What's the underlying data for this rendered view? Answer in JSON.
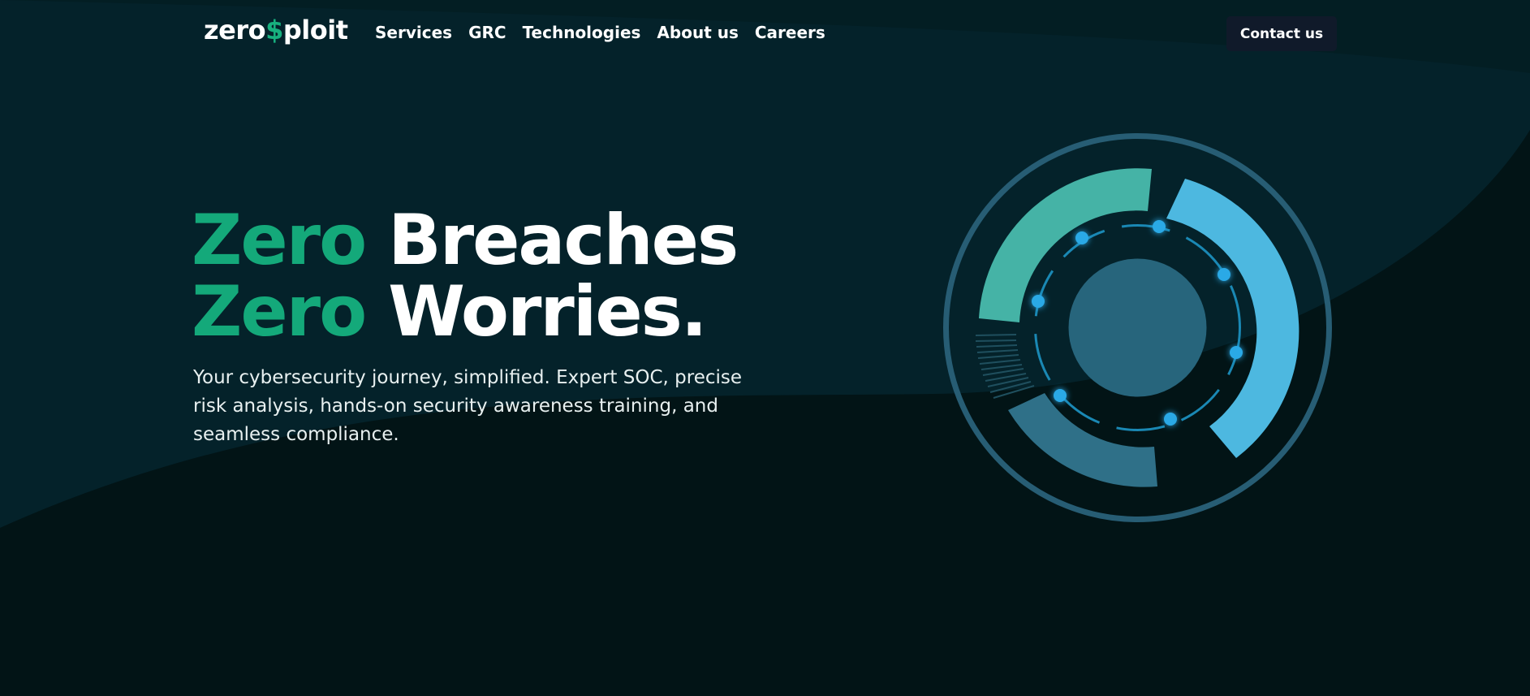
{
  "brand": {
    "logo_prefix": "zero",
    "logo_symbol": "$",
    "logo_suffix": "ploit"
  },
  "nav": {
    "items": [
      {
        "label": "Services"
      },
      {
        "label": "GRC"
      },
      {
        "label": "Technologies"
      },
      {
        "label": "About us"
      },
      {
        "label": "Careers"
      }
    ],
    "contact_label": "Contact us"
  },
  "hero": {
    "line1_accent": "Zero",
    "line1_rest": "Breaches",
    "line2_accent": "Zero",
    "line2_rest": "Worries.",
    "subtitle": "Your cybersecurity journey, simplified. Expert SOC, precise risk analysis, hands-on security awareness training, and seamless compliance."
  },
  "colors": {
    "background": "#03181b",
    "accent_green": "#14a97a",
    "ring_blue": "#4db8e0",
    "ring_teal": "#45b3a6",
    "ring_dark": "#2a6c85",
    "core": "#27657c"
  },
  "icons": {
    "graphic": "security-radar-graphic"
  }
}
